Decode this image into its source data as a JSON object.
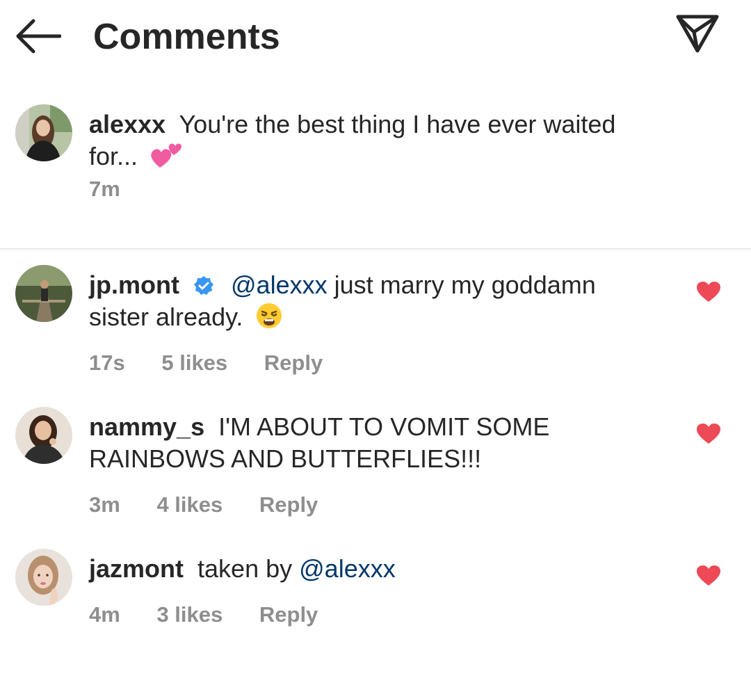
{
  "header": {
    "title": "Comments",
    "back_icon": "arrow-left-icon",
    "send_icon": "paper-plane-icon"
  },
  "caption": {
    "username": "alexxx",
    "text": "You're the best thing I have ever waited for...",
    "emoji": "two-hearts-emoji",
    "time": "7m"
  },
  "comments": [
    {
      "username": "jp.mont",
      "verified": true,
      "mention": "@alexxx",
      "text": "just marry my goddamn sister already.",
      "emoji": "weary-face-emoji",
      "time": "17s",
      "likes": "5 likes",
      "reply": "Reply",
      "liked": true
    },
    {
      "username": "nammy_s",
      "text": "I'M ABOUT TO VOMIT SOME RAINBOWS AND BUTTERFLIES!!!",
      "time": "3m",
      "likes": "4 likes",
      "reply": "Reply",
      "liked": true
    },
    {
      "username": "jazmont",
      "text": "taken by",
      "mention": "@alexxx",
      "time": "4m",
      "likes": "3 likes",
      "reply": "Reply",
      "liked": true
    }
  ],
  "colors": {
    "heart": "#ed4956",
    "mention": "#00376b",
    "meta": "#8e8e8e",
    "verified": "#3897f0"
  }
}
